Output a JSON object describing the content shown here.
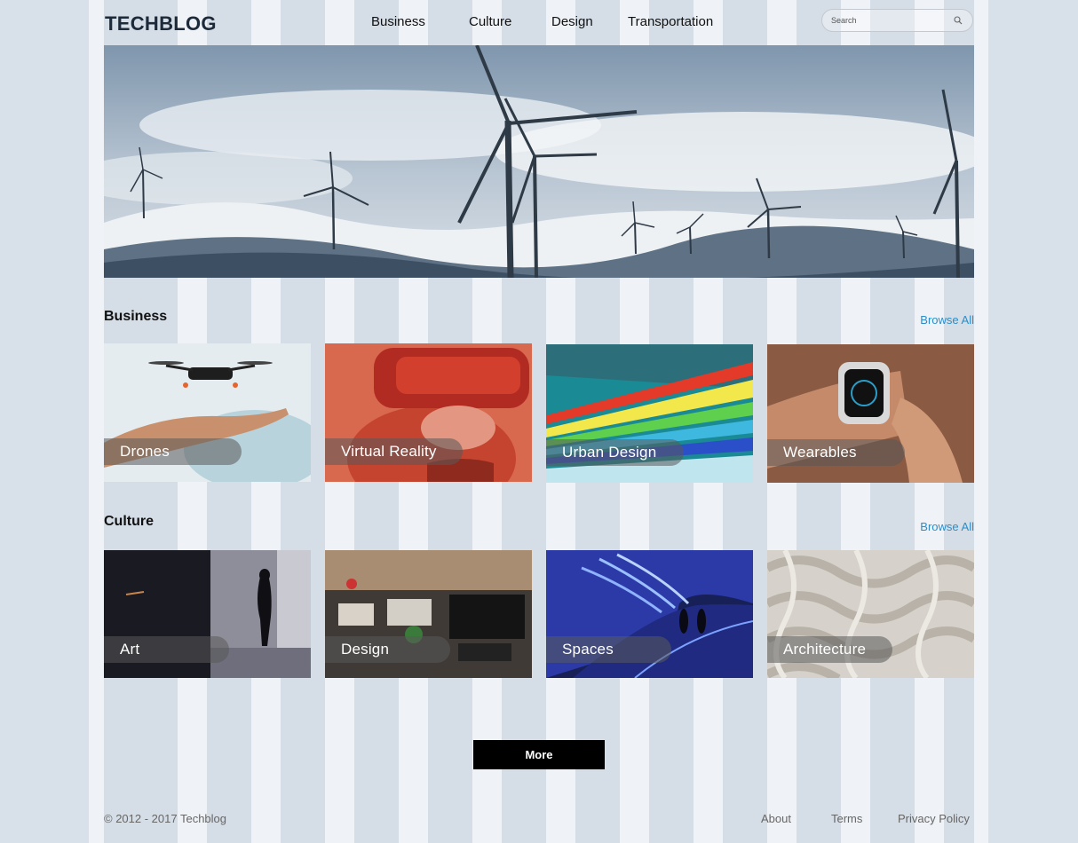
{
  "header": {
    "logo": "TECHBLOG",
    "nav": [
      "Business",
      "Culture",
      "Design",
      "Transportation"
    ],
    "search_placeholder": "Search"
  },
  "hero": {
    "image": "wind-turbines-snowy-hills"
  },
  "sections": [
    {
      "title": "Business",
      "browse_label": "Browse All",
      "cards": [
        {
          "label": "Drones",
          "image": "drone-over-hand"
        },
        {
          "label": "Virtual Reality",
          "image": "vr-headset-red"
        },
        {
          "label": "Urban Design",
          "image": "light-trails-tunnel"
        },
        {
          "label": "Wearables",
          "image": "smartwatch-wrist"
        }
      ]
    },
    {
      "title": "Culture",
      "browse_label": "Browse All",
      "cards": [
        {
          "label": "Art",
          "image": "silhouette-gallery"
        },
        {
          "label": "Design",
          "image": "office-desks"
        },
        {
          "label": "Spaces",
          "image": "blue-neon-tunnel"
        },
        {
          "label": "Architecture",
          "image": "woven-facade"
        }
      ]
    }
  ],
  "more_label": "More",
  "footer": {
    "copyright": "© 2012 - 2017 Techblog",
    "links": [
      "About",
      "Terms",
      "Privacy Policy"
    ]
  },
  "colors": {
    "background": "#d5dde6",
    "accent": "#2a8ec8",
    "logo": "#1d2a3a",
    "button": "#000000"
  }
}
